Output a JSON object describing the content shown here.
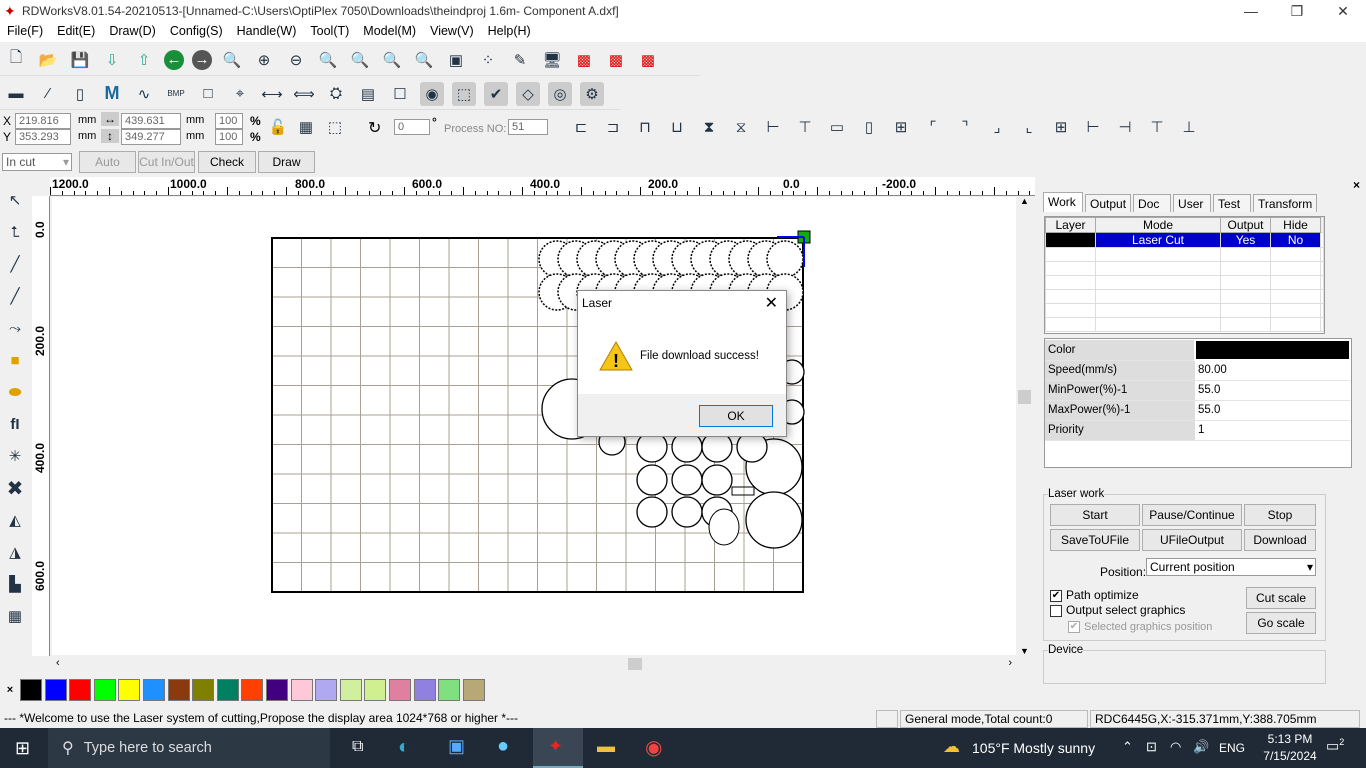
{
  "window": {
    "title": "RDWorksV8.01.54-20210513-[Unnamed-C:\\Users\\OptiPlex 7050\\Downloads\\theindproj 1.6m- Component A.dxf]"
  },
  "menu": [
    "File(F)",
    "Edit(E)",
    "Draw(D)",
    "Config(S)",
    "Handle(W)",
    "Tool(T)",
    "Model(M)",
    "View(V)",
    "Help(H)"
  ],
  "coords": {
    "x_label": "X",
    "x": "219.816",
    "y_label": "Y",
    "y": "353.293",
    "unit": "mm",
    "w": "439.631",
    "h": "349.277",
    "sx": "100",
    "sy": "100",
    "pct": "%",
    "angle": "0",
    "deg": "°",
    "process_label": "Process NO:",
    "process": "51"
  },
  "toolbar4": {
    "mode": "In cut",
    "auto": "Auto",
    "cut_in_out": "Cut In/Out",
    "check": "Check",
    "draw": "Draw"
  },
  "ruler": {
    "top": [
      "1200.0",
      "1000.0",
      "800.0",
      "600.0",
      "400.0",
      "200.0",
      "0.0",
      "-200.0"
    ],
    "left": [
      "0.0",
      "200.0",
      "400.0",
      "600.0"
    ]
  },
  "palette": [
    "#000000",
    "#0000ff",
    "#ff0000",
    "#00ff00",
    "#ffff00",
    "#1e90ff",
    "#8b3a0f",
    "#808000",
    "#008060",
    "#ff4000",
    "#400080",
    "#ffc8d8",
    "#b0a8f0",
    "#d0f0a0",
    "#d0f090",
    "#e080a0",
    "#9080e0",
    "#80e080",
    "#b8a878"
  ],
  "panel": {
    "tabs": [
      "Work",
      "Output",
      "Doc",
      "User",
      "Test",
      "Transform"
    ],
    "layer_headers": [
      "Layer",
      "Mode",
      "Output",
      "Hide"
    ],
    "layer_rows": [
      {
        "color": "#000000",
        "mode": "Laser Cut",
        "output": "Yes",
        "hide": "No"
      }
    ],
    "props": [
      {
        "k": "Color",
        "v": ""
      },
      {
        "k": "Speed(mm/s)",
        "v": "80.00"
      },
      {
        "k": "MinPower(%)-1",
        "v": "55.0"
      },
      {
        "k": "MaxPower(%)-1",
        "v": "55.0"
      },
      {
        "k": "Priority",
        "v": "1"
      }
    ],
    "laser_work": "Laser work",
    "start": "Start",
    "pause": "Pause/Continue",
    "stop": "Stop",
    "save_ufile": "SaveToUFile",
    "ufile_output": "UFileOutput",
    "download": "Download",
    "position_label": "Position:",
    "position": "Current position",
    "path_optimize": "Path optimize",
    "output_select": "Output select graphics",
    "selected_pos": "Selected graphics position",
    "cut_scale": "Cut scale",
    "go_scale": "Go scale",
    "device": "Device"
  },
  "dialog": {
    "title": "Laser",
    "message": "File download success!",
    "ok": "OK"
  },
  "status": {
    "welcome": "--- *Welcome to use the Laser system of cutting,Propose the display area 1024*768 or higher *---",
    "mode": "General mode,Total count:0",
    "device": "RDC6445G,X:-315.371mm,Y:388.705mm"
  },
  "taskbar": {
    "search": "Type here to search",
    "weather": "105°F  Mostly sunny",
    "lang": "ENG",
    "time": "5:13 PM",
    "date": "7/15/2024",
    "notif": "2"
  }
}
